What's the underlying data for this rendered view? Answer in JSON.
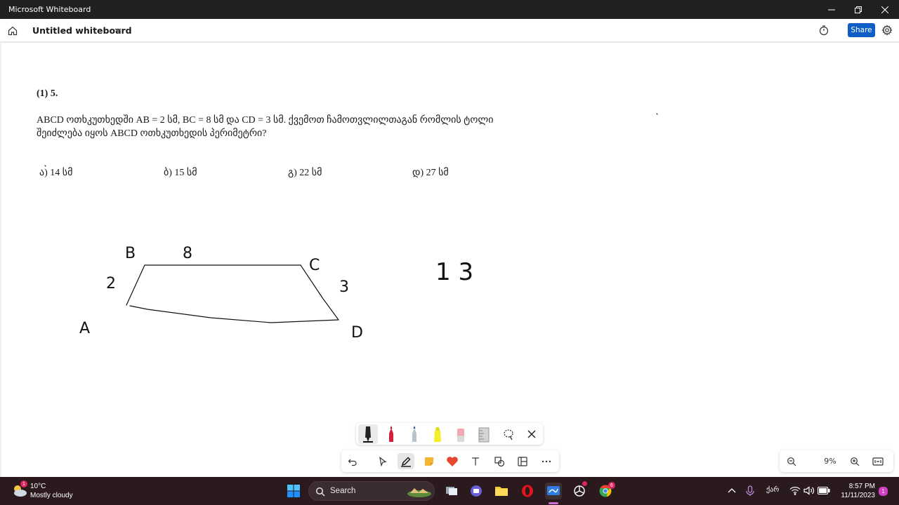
{
  "window": {
    "title": "Microsoft Whiteboard"
  },
  "header": {
    "board_title": "Untitled whiteboard",
    "share_label": "Share"
  },
  "question": {
    "number": "(1) 5.",
    "line1": "ABCD ოთხკუთხედში  AB = 2 სმ,  BC = 8 სმ და  CD = 3 სმ. ქვემოთ ჩამოთვლილთაგან რომლის ტოლი",
    "line2": "შეიძლება იყოს  ABCD ოთხკუთხედის პერიმეტრი?",
    "options": [
      "ა) 14 სმ",
      "ბ) 15 სმ",
      "გ) 22 სმ",
      "დ) 27 სმ"
    ]
  },
  "ink": {
    "label_B": "B",
    "label_8": "8",
    "label_C": "C",
    "label_2": "2",
    "label_3": "3",
    "label_A": "A",
    "label_D": "D",
    "note_13": "1 3"
  },
  "zoom": {
    "value": "9%"
  },
  "taskbar": {
    "temperature": "10°C",
    "condition": "Mostly cloudy",
    "weather_badge": "1",
    "search_label": "Search",
    "language": "ქარ",
    "time": "8:57 PM",
    "date": "11/11/2023",
    "chrome_badge": "6",
    "notification_badge": "1"
  },
  "colors": {
    "share": "#0f5ec8",
    "taskbar": "#2a1a1d",
    "ink": "#111111"
  }
}
